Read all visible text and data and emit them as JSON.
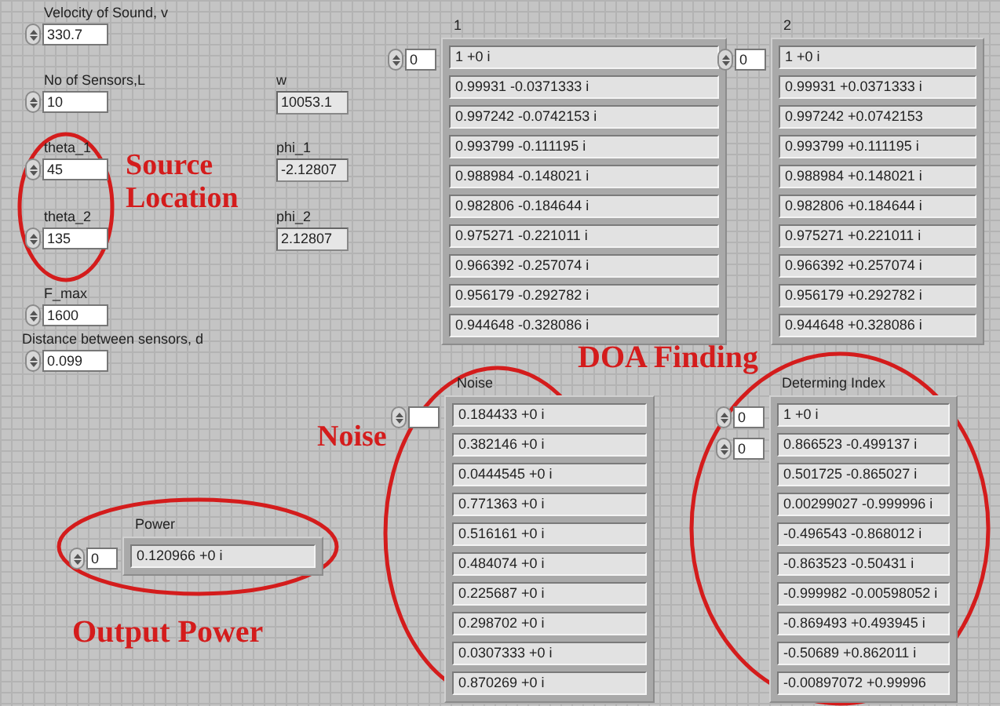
{
  "controls": [
    {
      "label": "Velocity of Sound, v",
      "value": "330.7"
    },
    {
      "label": "No of Sensors,L",
      "value": "10"
    },
    {
      "label": "theta_1",
      "value": "45"
    },
    {
      "label": "theta_2",
      "value": "135"
    },
    {
      "label": "F_max",
      "value": "1600"
    },
    {
      "label": "Distance between sensors, d",
      "value": "0.099"
    }
  ],
  "indicators": [
    {
      "label": "w",
      "value": "10053.1"
    },
    {
      "label": "phi_1",
      "value": "-2.12807"
    },
    {
      "label": "phi_2",
      "value": "2.12807"
    }
  ],
  "arrays": [
    {
      "label": "1",
      "index": [
        "0"
      ],
      "elements": [
        "1 +0 i",
        "0.99931 -0.0371333 i",
        "0.997242 -0.0742153 i",
        "0.993799 -0.111195 i",
        "0.988984 -0.148021 i",
        "0.982806 -0.184644 i",
        "0.975271 -0.221011 i",
        "0.966392 -0.257074 i",
        "0.956179 -0.292782 i",
        "0.944648 -0.328086 i"
      ]
    },
    {
      "label": "2",
      "index": [
        "0"
      ],
      "elements": [
        "1 +0 i",
        "0.99931 +0.0371333 i",
        "0.997242 +0.0742153",
        "0.993799 +0.111195 i",
        "0.988984 +0.148021 i",
        "0.982806 +0.184644 i",
        "0.975271 +0.221011 i",
        "0.966392 +0.257074 i",
        "0.956179 +0.292782 i",
        "0.944648 +0.328086 i"
      ]
    },
    {
      "label": "Noise",
      "elements": [
        "0.184433 +0 i",
        "0.382146 +0 i",
        "0.0444545 +0 i",
        "0.771363 +0 i",
        "0.516161 +0 i",
        "0.484074 +0 i",
        "0.225687 +0 i",
        "0.298702 +0 i",
        "0.0307333 +0 i",
        "0.870269 +0 i"
      ]
    },
    {
      "label": "Determing Index",
      "index": [
        "0",
        "0"
      ],
      "elements": [
        "1 +0 i",
        "0.866523 -0.499137 i",
        "0.501725 -0.865027 i",
        "0.00299027 -0.999996 i",
        "-0.496543 -0.868012 i",
        "-0.863523 -0.50431 i",
        "-0.999982 -0.00598052 i",
        "-0.869493 +0.493945 i",
        "-0.50689 +0.862011 i",
        "-0.00897072 +0.99996"
      ]
    },
    {
      "label": "Power",
      "index": [
        "0"
      ],
      "elements": [
        "0.120966 +0 i"
      ]
    }
  ],
  "annotations": [
    {
      "text": "Source Location"
    },
    {
      "text": "DOA Finding"
    },
    {
      "text": "Noise"
    },
    {
      "text": "Output Power"
    }
  ]
}
